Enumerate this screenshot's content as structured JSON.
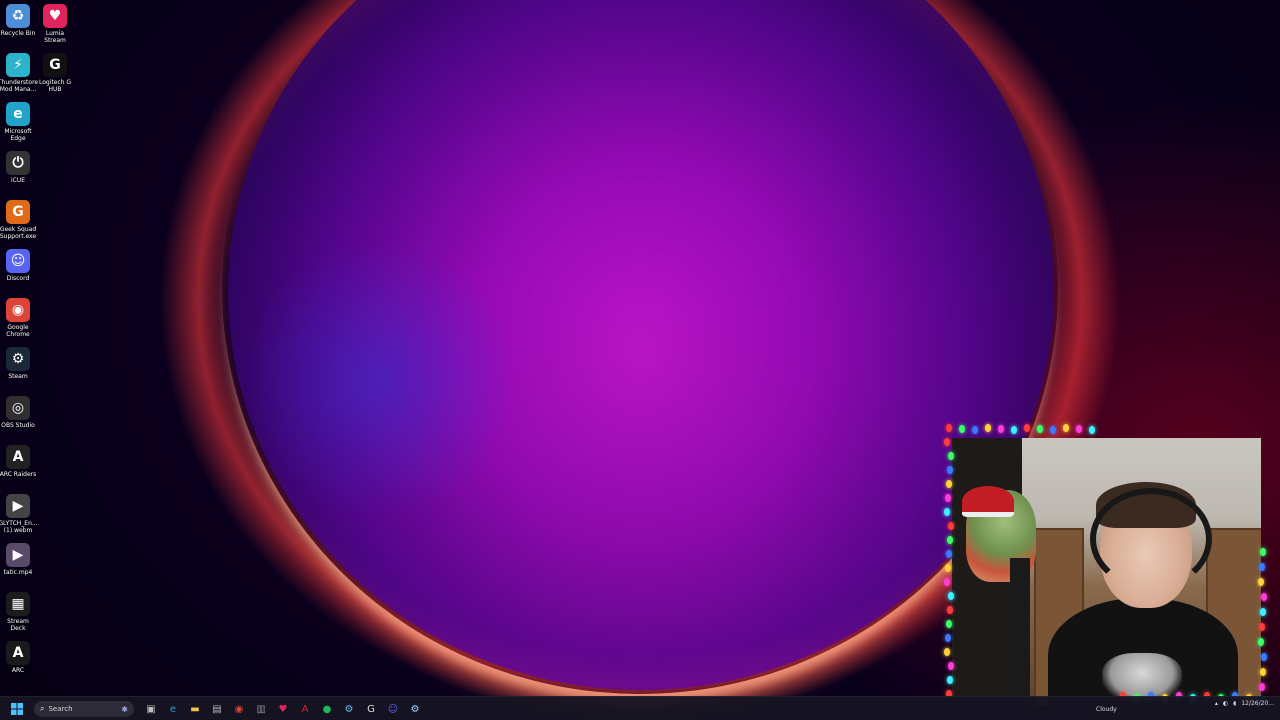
{
  "desktop": {
    "icons_col1": [
      {
        "label": "Recycle Bin",
        "icon": "recycle-bin-icon",
        "color": "#4a8fd6",
        "glyph": "♻"
      },
      {
        "label": "Thunderstore\nMod Mana...",
        "icon": "thunderstore-icon",
        "color": "#2bb3c9",
        "glyph": "⚡"
      },
      {
        "label": "Microsoft\nEdge",
        "icon": "edge-icon",
        "color": "#1fa3c8",
        "glyph": "e"
      },
      {
        "label": "iCUE",
        "icon": "icue-icon",
        "color": "#333333",
        "glyph": "⏻"
      },
      {
        "label": "Geek Squad\nSupport.exe",
        "icon": "geek-squad-icon",
        "color": "#e06a17",
        "glyph": "G"
      },
      {
        "label": "Discord",
        "icon": "discord-icon",
        "color": "#5865f2",
        "glyph": "☺"
      },
      {
        "label": "Google\nChrome",
        "icon": "chrome-icon",
        "color": "#db4437",
        "glyph": "◉"
      },
      {
        "label": "Steam",
        "icon": "steam-icon",
        "color": "#1b2838",
        "glyph": "⚙"
      },
      {
        "label": "OBS Studio",
        "icon": "obs-icon",
        "color": "#302e31",
        "glyph": "◎"
      },
      {
        "label": "ARC Raiders",
        "icon": "arc-raiders-icon",
        "color": "#222222",
        "glyph": "A"
      },
      {
        "label": "GLYTCH_En...\n(1).webm",
        "icon": "video-file-icon",
        "color": "#444444",
        "glyph": "▶"
      },
      {
        "label": "tatic.mp4",
        "icon": "mp4-file-icon",
        "color": "#5a4a6a",
        "glyph": "▶"
      },
      {
        "label": "Stream Deck",
        "icon": "stream-deck-icon",
        "color": "#1c1c1c",
        "glyph": "▦"
      },
      {
        "label": "ARC",
        "icon": "arc-icon",
        "color": "#1a1a1a",
        "glyph": "A"
      }
    ],
    "icons_col2": [
      {
        "label": "Lumia\nStream",
        "icon": "lumia-stream-icon",
        "color": "#e0245e",
        "glyph": "♥"
      },
      {
        "label": "Logitech G\nHUB",
        "icon": "logitech-ghub-icon",
        "color": "#111111",
        "glyph": "G"
      }
    ]
  },
  "taskbar": {
    "search_placeholder": "Search",
    "apps": [
      {
        "icon": "task-view-icon",
        "color": "#bfbfbf",
        "glyph": "▣"
      },
      {
        "icon": "edge-icon",
        "color": "#1fa3c8",
        "glyph": "e"
      },
      {
        "icon": "file-explorer-icon",
        "color": "#f2c14e",
        "glyph": "▬"
      },
      {
        "icon": "store-icon",
        "color": "#bbbbbb",
        "glyph": "▤"
      },
      {
        "icon": "chrome-icon",
        "color": "#db4437",
        "glyph": "◉"
      },
      {
        "icon": "app-icon",
        "color": "#888888",
        "glyph": "▥"
      },
      {
        "icon": "lumia-stream-icon",
        "color": "#e0245e",
        "glyph": "♥"
      },
      {
        "icon": "adobe-icon",
        "color": "#d2202f",
        "glyph": "A"
      },
      {
        "icon": "spotify-icon",
        "color": "#1db954",
        "glyph": "●"
      },
      {
        "icon": "steam-icon",
        "color": "#66c0f4",
        "glyph": "⚙"
      },
      {
        "icon": "logitech-ghub-icon",
        "color": "#dddddd",
        "glyph": "G"
      },
      {
        "icon": "discord-icon",
        "color": "#5865f2",
        "glyph": "☺"
      },
      {
        "icon": "steam-icon",
        "color": "#9fd3ff",
        "glyph": "⚙"
      }
    ],
    "weather": "Cloudy",
    "time": "",
    "date": "12/26/20..."
  }
}
